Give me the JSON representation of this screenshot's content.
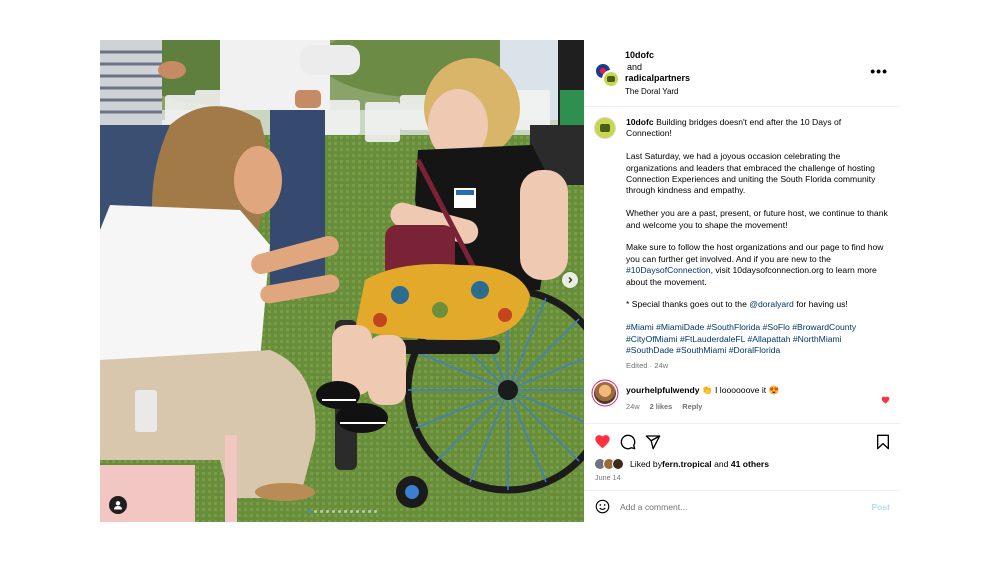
{
  "post_header": {
    "author1": "10dofc",
    "conjunction": "and",
    "author2": "radicalpartners",
    "location": "The Doral Yard",
    "more_icon": "ellipsis-horizontal-icon"
  },
  "caption": {
    "username": "10dofc",
    "first_text": " Building bridges doesn't end after the 10 Days of Connection!",
    "p2": "Last Saturday, we had a joyous occasion celebrating the organizations and leaders that embraced the challenge of hosting Connection Experiences and uniting the South Florida community through kindness and empathy.",
    "p3": "Whether you are a past, present, or future host, we continue to thank and welcome you to shape the movement!",
    "p4_a": "Make sure to follow the host organizations and our page to find how you can further get involved. And if you are new to the ",
    "p4_link": "#10DaysofConnection",
    "p4_b": ", visit 10daysofconnection.org to learn more about the movement.",
    "p5_a": "* Special thanks goes out to the ",
    "p5_link": "@doralyard",
    "p5_b": " for having us!",
    "hashtags": "#Miami #MiamiDade #SouthFlorida #SoFlo #BrowardCounty #CityOfMiami #FtLauderdaleFL #Allapattah #NorthMiami #SouthDade #SouthMiami #DoralFlorida",
    "edited": "Edited · 24w"
  },
  "comment": {
    "username": "yourhelpfulwendy",
    "text": " 👏 I loooooove it 😍",
    "time": "24w",
    "likes": "2 likes",
    "reply": "Reply"
  },
  "likes": {
    "prefix": "Liked by ",
    "user": "fern.tropical",
    "mid": " and ",
    "others": "41 others"
  },
  "date": "June 14",
  "add_comment": {
    "placeholder": "Add a comment...",
    "post": "Post"
  },
  "carousel": {
    "slide_count": 12,
    "active_index": 0
  },
  "colors": {
    "heart_red": "#ff3040",
    "link": "#00376b",
    "dot_active": "#3b8cf0",
    "post_disabled": "#b3dbff"
  }
}
